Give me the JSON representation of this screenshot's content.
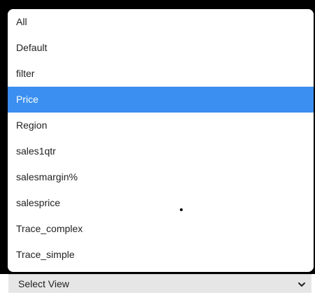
{
  "dropdown": {
    "options": [
      {
        "label": "All",
        "selected": false
      },
      {
        "label": "Default",
        "selected": false
      },
      {
        "label": "filter",
        "selected": false
      },
      {
        "label": "Price",
        "selected": true
      },
      {
        "label": "Region",
        "selected": false
      },
      {
        "label": "sales1qtr",
        "selected": false
      },
      {
        "label": "salesmargin%",
        "selected": false
      },
      {
        "label": "salesprice",
        "selected": false
      },
      {
        "label": "Trace_complex",
        "selected": false
      },
      {
        "label": "Trace_simple",
        "selected": false
      }
    ],
    "highlight_color": "#3b8ff0"
  },
  "select": {
    "label": "Select View",
    "icon": "chevron-down-icon"
  }
}
